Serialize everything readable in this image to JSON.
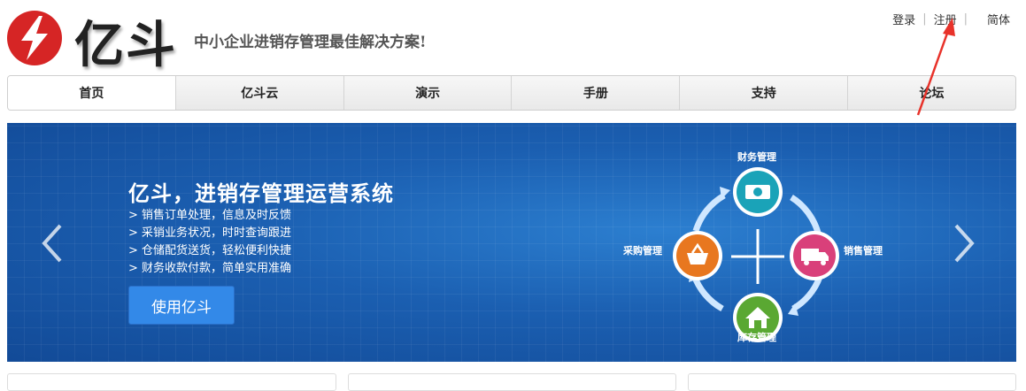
{
  "brand": {
    "name": "亿斗",
    "tagline": "中小企业进销存管理最佳解决方案!",
    "color": "#d62525"
  },
  "toplinks": {
    "login": "登录",
    "register": "注册",
    "lang": "简体",
    "separator": "|"
  },
  "nav": {
    "items": [
      {
        "label": "首页",
        "active": true
      },
      {
        "label": "亿斗云"
      },
      {
        "label": "演示"
      },
      {
        "label": "手册"
      },
      {
        "label": "支持"
      },
      {
        "label": "论坛"
      }
    ]
  },
  "banner": {
    "title": "亿斗，进销存管理运营系统",
    "features": [
      "> 销售订单处理，信息及时反馈",
      "> 采销业务状况，时时查询跟进",
      "> 仓储配货送货，轻松便利快捷",
      "> 财务收款付款，简单实用准确"
    ],
    "cta": "使用亿斗",
    "diagram": {
      "top": "财务管理",
      "left": "采购管理",
      "right": "销售管理",
      "bottom": "库存管理",
      "colors": {
        "finance": "#1aa3b8",
        "purchase": "#e8771f",
        "sales": "#d9407a",
        "stock": "#5aa832"
      }
    }
  },
  "annotation": {
    "arrow_color": "#e8322a"
  }
}
